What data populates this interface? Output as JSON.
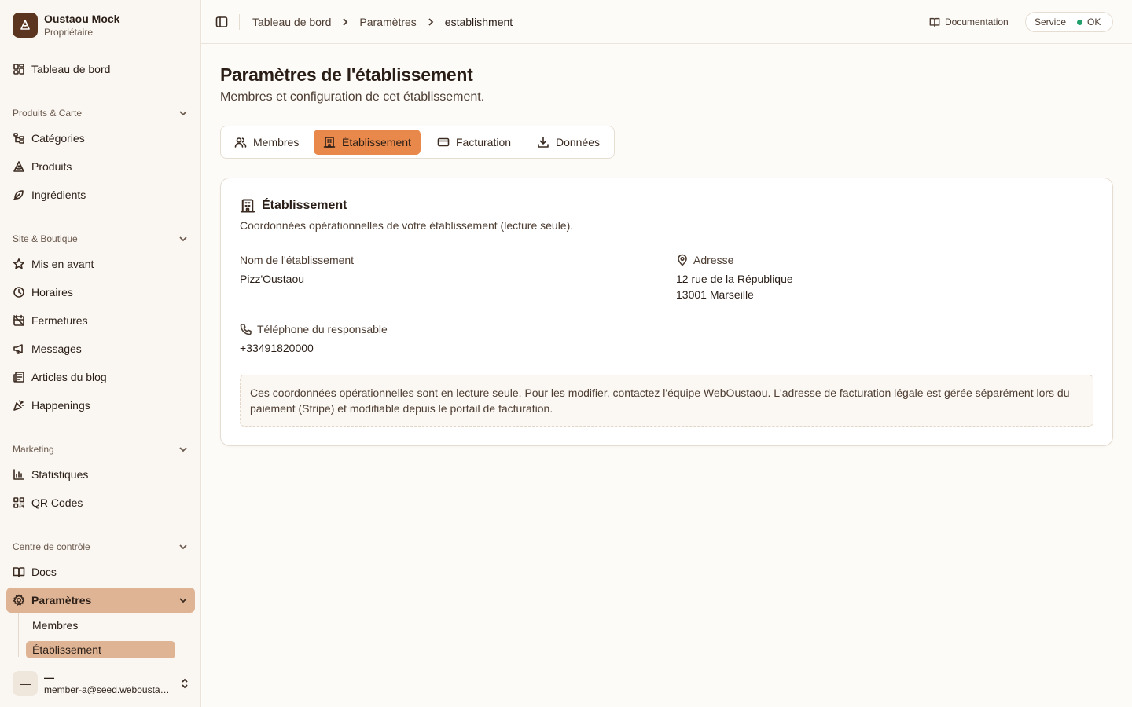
{
  "brand": {
    "name": "Oustaou Mock",
    "role": "Propriétaire"
  },
  "sidebar": {
    "dashboard": "Tableau de bord",
    "groups": [
      {
        "label": "Produits & Carte",
        "items": [
          "Catégories",
          "Produits",
          "Ingrédients"
        ]
      },
      {
        "label": "Site & Boutique",
        "items": [
          "Mis en avant",
          "Horaires",
          "Fermetures",
          "Messages",
          "Articles du blog",
          "Happenings"
        ]
      },
      {
        "label": "Marketing",
        "items": [
          "Statistiques",
          "QR Codes"
        ]
      },
      {
        "label": "Centre de contrôle",
        "items": [
          "Docs",
          "Paramètres"
        ]
      }
    ],
    "settings_sub": [
      "Membres",
      "Établissement"
    ]
  },
  "user": {
    "avatar": "—",
    "name": "—",
    "email": "member-a@seed.weboustaou.fr"
  },
  "topbar": {
    "breadcrumbs": [
      "Tableau de bord",
      "Paramètres",
      "establishment"
    ],
    "docs_label": "Documentation",
    "status_label": "Service",
    "status_value": "OK",
    "status_color": "#22a06b"
  },
  "page": {
    "title": "Paramètres de l'établissement",
    "subtitle": "Membres et configuration de cet établissement."
  },
  "tabs": [
    "Membres",
    "Établissement",
    "Facturation",
    "Données"
  ],
  "card": {
    "title": "Établissement",
    "subtitle": "Coordonnées opérationnelles de votre établissement (lecture seule).",
    "name_label": "Nom de l'établissement",
    "name_value": "Pizz'Oustaou",
    "address_label": "Adresse",
    "address_line1": "12 rue de la République",
    "address_line2": "13001 Marseille",
    "phone_label": "Téléphone du responsable",
    "phone_value": "+33491820000",
    "note": "Ces coordonnées opérationnelles sont en lecture seule. Pour les modifier, contactez l'équipe WebOustaou. L'adresse de facturation légale est gérée séparément lors du paiement (Stripe) et modifiable depuis le portail de facturation."
  },
  "colors": {
    "accent": "#e8884a",
    "sidebar_active": "#dfb495",
    "brand_logo": "#5b3520"
  }
}
